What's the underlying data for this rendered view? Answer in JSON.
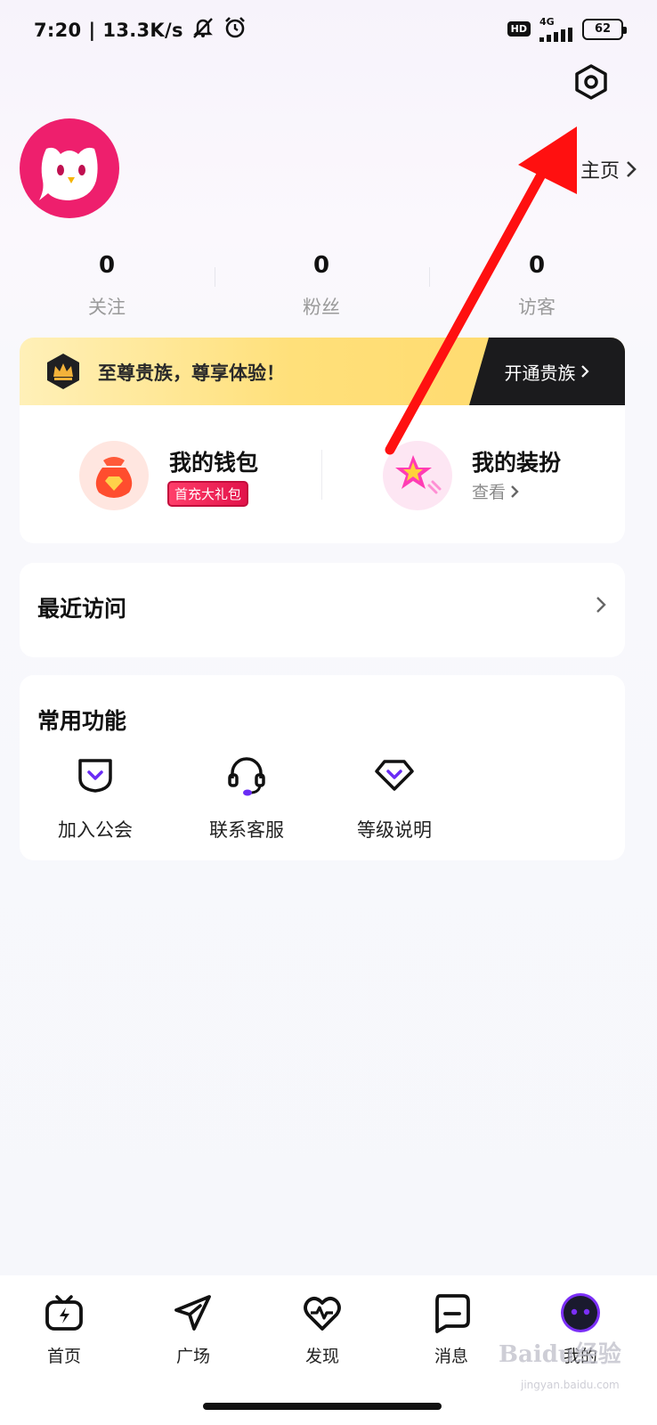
{
  "status_bar": {
    "time": "7:20",
    "separator": "|",
    "speed": "13.3K/s",
    "hd": "HD",
    "network": "4G",
    "battery": "62"
  },
  "profile": {
    "homepage_link": "主页",
    "stats": [
      {
        "value": "0",
        "label": "关注"
      },
      {
        "value": "0",
        "label": "粉丝"
      },
      {
        "value": "0",
        "label": "访客"
      }
    ]
  },
  "noble_banner": {
    "text": "至尊贵族，尊享体验！",
    "cta": "开通贵族"
  },
  "wallet": {
    "title": "我的钱包",
    "tag": "首充大礼包"
  },
  "outfit": {
    "title": "我的装扮",
    "subtitle": "查看"
  },
  "recent_visits": {
    "title": "最近访问"
  },
  "common_functions": {
    "title": "常用功能",
    "items": [
      {
        "label": "加入公会",
        "icon": "guild-icon"
      },
      {
        "label": "联系客服",
        "icon": "headset-icon"
      },
      {
        "label": "等级说明",
        "icon": "level-icon"
      }
    ]
  },
  "tab_bar": {
    "items": [
      {
        "label": "首页",
        "icon": "tv-icon"
      },
      {
        "label": "广场",
        "icon": "paper-plane-icon"
      },
      {
        "label": "发现",
        "icon": "heart-pulse-icon"
      },
      {
        "label": "消息",
        "icon": "message-icon"
      },
      {
        "label": "我的",
        "icon": "avatar-icon"
      }
    ]
  },
  "watermark": {
    "text": "Baidu经验",
    "url_text": "jingyan.baidu.com"
  },
  "colors": {
    "avatar_bg": "#ee1f6d",
    "accent_purple": "#6a2cf5",
    "noble_gold": "#ffd86a",
    "arrow_red": "#ff1010"
  }
}
